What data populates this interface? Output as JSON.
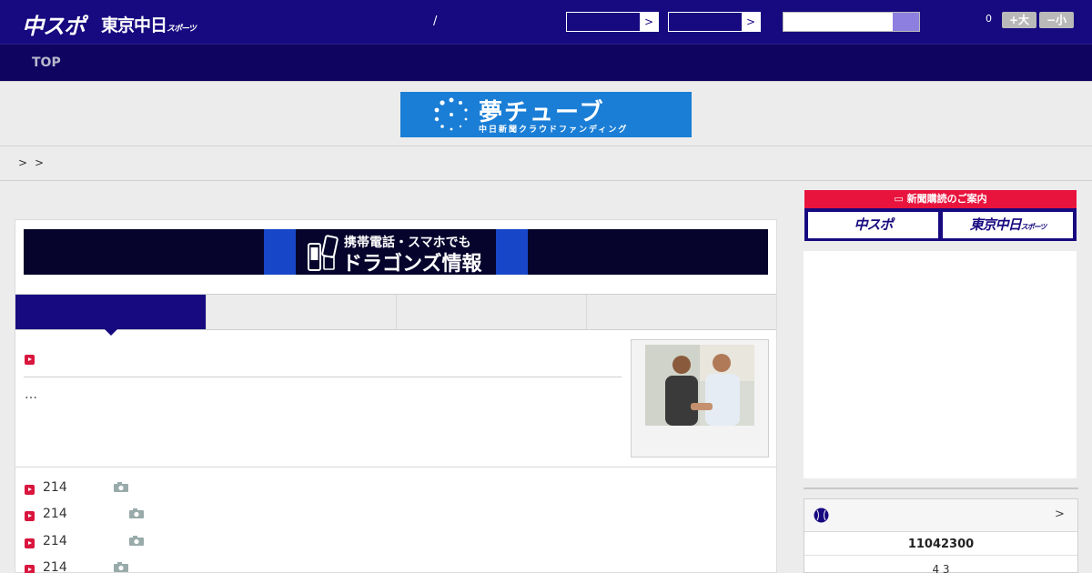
{
  "header": {
    "logo_chuspo": "中スポ",
    "logo_tokyo": "東京中日",
    "logo_tokyo_suffix": "スポーツ",
    "separator": "/",
    "select1_arrow": ">",
    "select2_arrow": ">",
    "counter": "0",
    "font_larger": "+大",
    "font_smaller": "−小"
  },
  "nav": {
    "top": "TOP"
  },
  "banner_yume": {
    "title": "夢チューブ",
    "subtitle": "中日新聞クラウドファンディング"
  },
  "breadcrumb": {
    "sep1": ">",
    "sep2": ">"
  },
  "banner_mobile": {
    "line1": "携帯電話・スマホでも",
    "line2": "ドラゴンズ情報"
  },
  "feature": {
    "excerpt": "…"
  },
  "list": [
    {
      "num": "214"
    },
    {
      "num": "214"
    },
    {
      "num": "214"
    },
    {
      "num": "214"
    }
  ],
  "sidebar": {
    "subscribe_title": "新聞購読のご案内",
    "subscribe_chuspo": "中スポ",
    "subscribe_tokyo": "東京中日",
    "subscribe_tokyo_suffix": "スポーツ",
    "score_more": ">",
    "score_number": "11042300",
    "score_sub": "4  3"
  },
  "colors": {
    "header": "#17097f",
    "nav": "#0f0460",
    "accent": "#e8143d",
    "yume": "#1a7ed6"
  }
}
